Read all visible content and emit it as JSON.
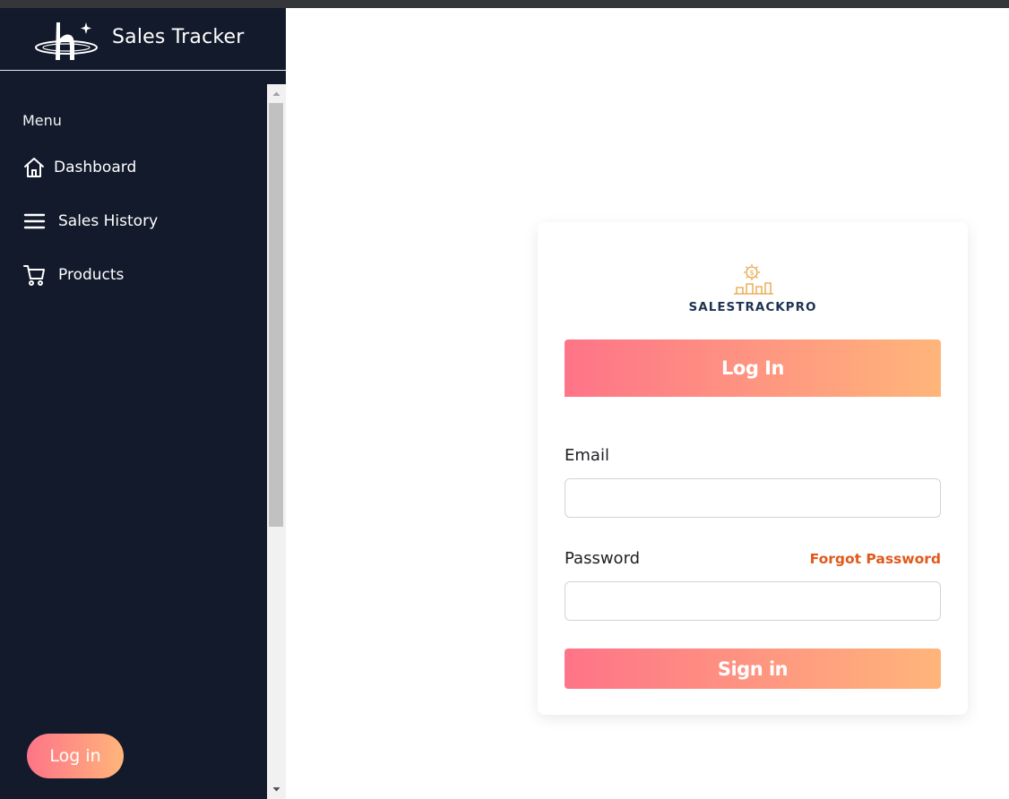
{
  "sidebar": {
    "brand_title": "Sales Tracker",
    "logo_icon": "h-planet-logo-icon",
    "menu_heading": "Menu",
    "items": [
      {
        "label": "Dashboard",
        "icon": "home-icon"
      },
      {
        "label": "Sales History",
        "icon": "menu-lines-icon"
      },
      {
        "label": "Products",
        "icon": "cart-icon"
      }
    ],
    "login_label": "Log in"
  },
  "login_card": {
    "brand_name": "SALESTRACKPRO",
    "brand_icon": "gear-dollar-bar-chart-icon",
    "header": "Log In",
    "email_label": "Email",
    "email_value": "",
    "password_label": "Password",
    "password_value": "",
    "forgot_password": "Forgot Password",
    "signin_label": "Sign in"
  },
  "colors": {
    "sidebar_bg": "#121a2b",
    "gradient_start": "#fe7488",
    "gradient_end": "#ffb57a",
    "link_accent": "#e05a1b",
    "brand_text": "#1e3352"
  }
}
